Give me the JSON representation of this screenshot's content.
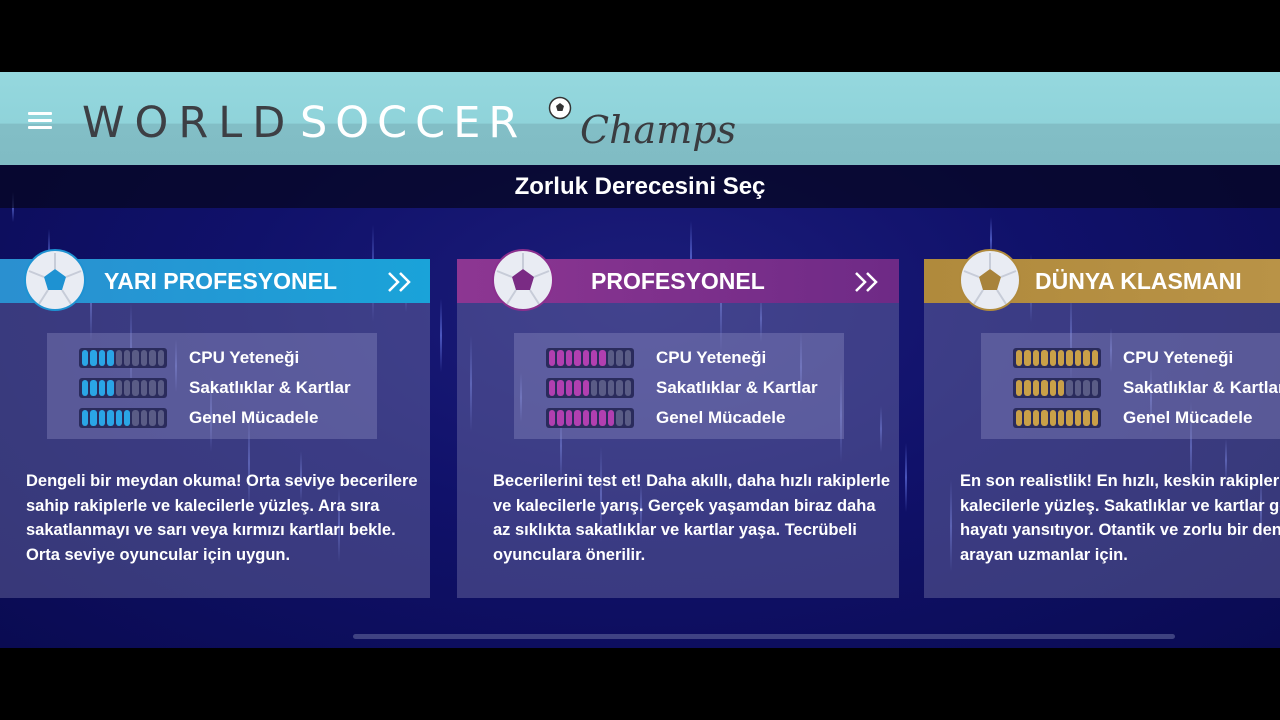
{
  "logo": {
    "world": "WORLD",
    "soccer": "SOCCER",
    "champs": "Champs"
  },
  "title": "Zorluk Derecesini Seç",
  "stat_labels": [
    "CPU Yeteneği",
    "Sakatlıklar & Kartlar",
    "Genel Mücadele"
  ],
  "cards": [
    {
      "title": "YARI PROFESYONEL",
      "color": "#1e92d2",
      "segment_color": "#2aa5e6",
      "stats_filled_of_10": [
        4,
        4,
        6
      ],
      "description": "Dengeli bir meydan okuma! Orta seviye becerilere sahip rakiplerle ve kalecilerle yüzleş. Ara sıra sakatlanmayı ve sarı veya kırmızı kartları bekle. Orta seviye oyuncular için uygun."
    },
    {
      "title": "PROFESYONEL",
      "color": "#8b2f8e",
      "segment_color": "#b13fb0",
      "stats_filled_of_10": [
        7,
        5,
        8
      ],
      "description": "Becerilerini test et! Daha akıllı, daha hızlı rakiplerle ve kalecilerle yarış. Gerçek yaşamdan biraz daha az sıklıkta sakatlıklar ve kartlar yaşa. Tecrübeli oyunculara önerilir."
    },
    {
      "title": "DÜNYA KLASMANI",
      "color": "#b08a3c",
      "segment_color": "#c9a048",
      "stats_filled_of_10": [
        10,
        6,
        10
      ],
      "description": "En son realistlik! En hızlı, keskin rakiplerle ve kalecilerle yüzleş. Sakatlıklar ve kartlar gerçek hayatı yansıtıyor. Otantik ve zorlu bir deneyim arayan uzmanlar için."
    }
  ]
}
